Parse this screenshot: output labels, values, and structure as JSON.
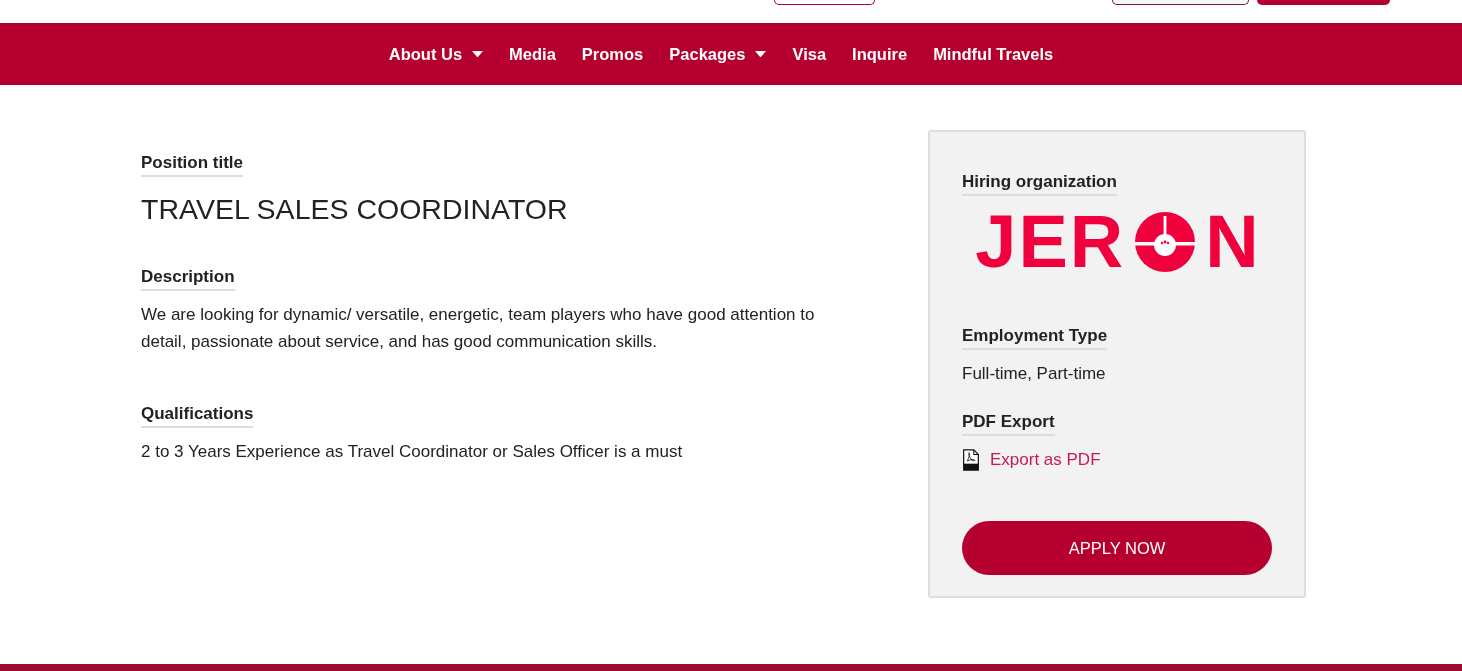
{
  "header_buttons": [
    {
      "kind": "outline"
    },
    {
      "kind": "outline_dark"
    },
    {
      "kind": "filled"
    }
  ],
  "nav": [
    {
      "label": "About Us",
      "dropdown": true
    },
    {
      "label": "Media",
      "dropdown": false
    },
    {
      "label": "Promos",
      "dropdown": false
    },
    {
      "label": "Packages",
      "dropdown": true
    },
    {
      "label": "Visa",
      "dropdown": false
    },
    {
      "label": "Inquire",
      "dropdown": false
    },
    {
      "label": "Mindful Travels",
      "dropdown": false
    }
  ],
  "job": {
    "sections": [
      {
        "kind": "title",
        "label": "Position title",
        "value": "TRAVEL SALES COORDINATOR"
      },
      {
        "kind": "text",
        "label": "Description",
        "value": "We are looking for dynamic/ versatile, energetic, team players who have good attention to detail, passionate about service, and has good communication skills."
      },
      {
        "kind": "text",
        "label": "Qualifications",
        "value": "2 to 3 Years Experience as Travel Coordinator or Sales Officer is a must"
      }
    ]
  },
  "sidebar": {
    "organization": {
      "label": "Hiring organization",
      "logo": {
        "lead": "JER",
        "tail": "N"
      }
    },
    "employment": {
      "label": "Employment Type",
      "value": "Full-time, Part-time"
    },
    "pdf": {
      "label": "PDF Export",
      "link": "Export as PDF"
    },
    "apply_button": "APPLY NOW"
  }
}
